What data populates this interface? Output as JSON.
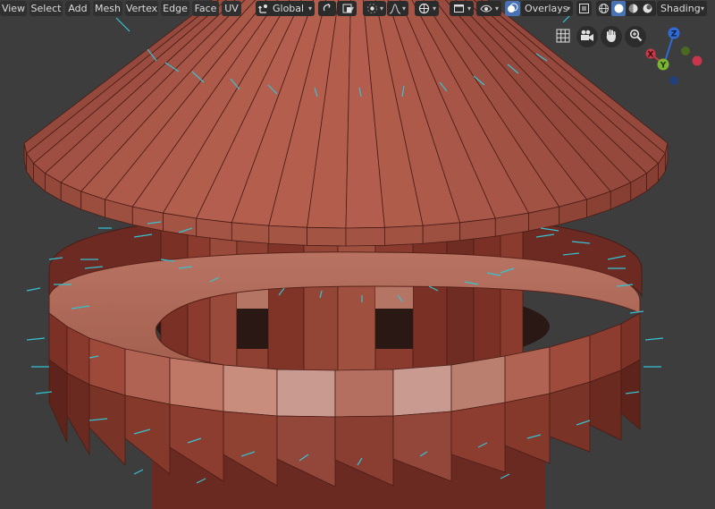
{
  "menus": [
    {
      "name": "menu-view",
      "label": "View"
    },
    {
      "name": "menu-select",
      "label": "Select"
    },
    {
      "name": "menu-add",
      "label": "Add"
    },
    {
      "name": "menu-mesh",
      "label": "Mesh"
    },
    {
      "name": "menu-vertex",
      "label": "Vertex"
    },
    {
      "name": "menu-edge",
      "label": "Edge"
    },
    {
      "name": "menu-face",
      "label": "Face"
    },
    {
      "name": "menu-uv",
      "label": "UV"
    }
  ],
  "header": {
    "transform_orientation": "Global",
    "overlays_label": "Overlays",
    "shading_label": "Shading"
  },
  "gizmo": {
    "axes": [
      {
        "name": "z-axis",
        "label": "Z",
        "color": "#2f6bd6"
      },
      {
        "name": "x-axis",
        "label": "X",
        "color": "#c73a47"
      },
      {
        "name": "y-axis",
        "label": "Y",
        "color": "#7bb531"
      }
    ]
  },
  "icons": [
    "move-icon",
    "pivot-icon",
    "snap-icon",
    "snap-target-icon",
    "proportional-icon",
    "falloff-icon",
    "proportional-edit-icon",
    "editor-type-icon",
    "visibility-icon",
    "overlays-icon",
    "xray-icon",
    "wireframe-shading-icon",
    "solid-shading-icon",
    "material-shading-icon",
    "rendered-shading-icon",
    "grid-view-icon",
    "camera-icon",
    "hand-pan-icon",
    "zoom-icon"
  ],
  "colors": {
    "background": "#3d3d3d",
    "header_button": "#2b2b2b",
    "active_button": "#4772b3",
    "mesh_dark": "#6e2c22",
    "mesh_mid": "#8f4637",
    "mesh_light": "#b46f60",
    "selected_face": "#c99a90",
    "normals": "#34c3d4"
  }
}
